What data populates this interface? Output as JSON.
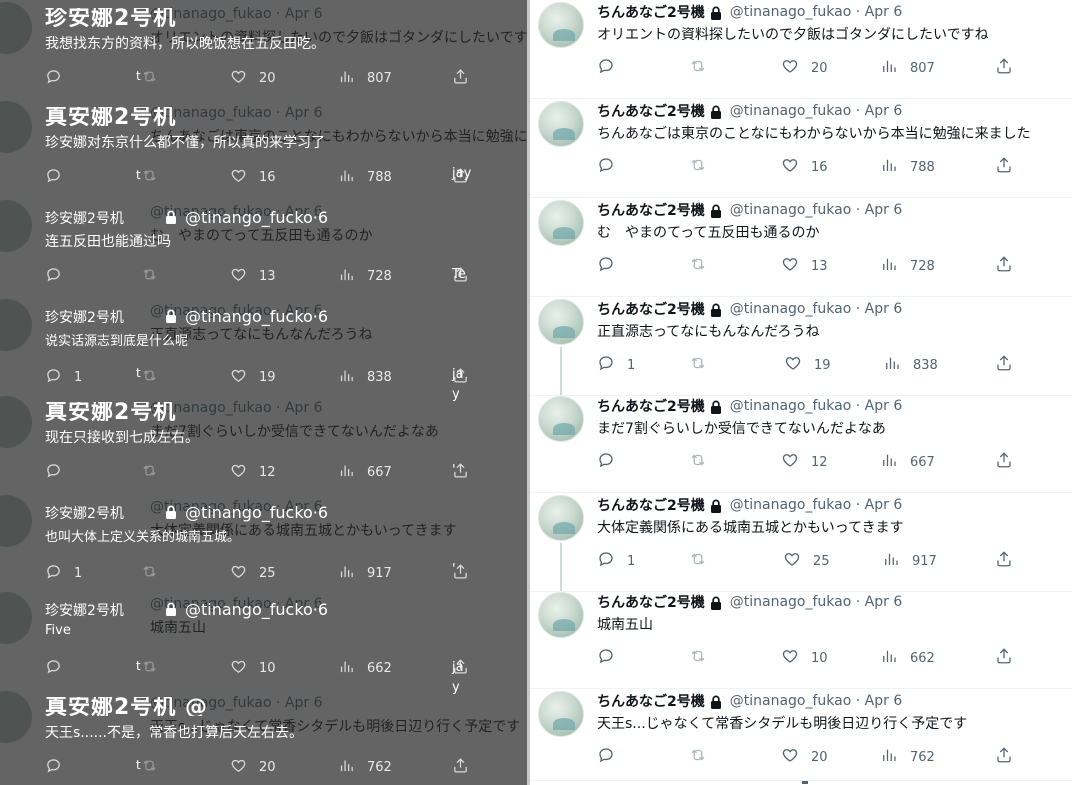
{
  "original_tweets": [
    {
      "name": "ちんあなご2号機",
      "handle": "@tinanago_fukao",
      "date": "Apr 6",
      "text": "オリエントの資料探したいので夕飯はゴタンダにしたいですね",
      "replies": "",
      "likes": "20",
      "views": "807"
    },
    {
      "name": "ちんあなご2号機",
      "handle": "@tinanago_fukao",
      "date": "Apr 6",
      "text": "ちんあなごは東京のことなにもわからないから本当に勉強に来ました",
      "replies": "",
      "likes": "16",
      "views": "788"
    },
    {
      "name": "ちんあなご2号機",
      "handle": "@tinanago_fukao",
      "date": "Apr 6",
      "text": "む　やまのてって五反田も通るのか",
      "replies": "",
      "likes": "13",
      "views": "728"
    },
    {
      "name": "ちんあなご2号機",
      "handle": "@tinanago_fukao",
      "date": "Apr 6",
      "text": "正直源志ってなにもんなんだろうね",
      "replies": "1",
      "likes": "19",
      "views": "838"
    },
    {
      "name": "ちんあなご2号機",
      "handle": "@tinanago_fukao",
      "date": "Apr 6",
      "text": "まだ7割ぐらいしか受信できてないんだよなあ",
      "replies": "",
      "likes": "12",
      "views": "667"
    },
    {
      "name": "ちんあなご2号機",
      "handle": "@tinanago_fukao",
      "date": "Apr 6",
      "text": "大体定義関係にある城南五城とかもいってきます",
      "replies": "1",
      "likes": "25",
      "views": "917"
    },
    {
      "name": "ちんあなご2号機",
      "handle": "@tinanago_fukao",
      "date": "Apr 6",
      "text": "城南五山",
      "replies": "",
      "likes": "10",
      "views": "662"
    },
    {
      "name": "ちんあなご2号機",
      "handle": "@tinanago_fukao",
      "date": "Apr 6",
      "text": "天王s...じゃなくて常香シタデルも明後日辺り行く予定です",
      "replies": "",
      "likes": "20",
      "views": "762"
    }
  ],
  "translated_tweets": [
    {
      "name": "珍安娜2号机",
      "handle_overlay": "",
      "text": "我想找东方的资料，所以晚饭想在五反田吃。",
      "replies": "",
      "retweet_mark": "t",
      "likes": "20",
      "views": "807",
      "side": ""
    },
    {
      "name": "真安娜2号机",
      "handle_overlay": "",
      "text": "珍安娜对东京什么都不懂，所以真的来学习了",
      "replies": "",
      "retweet_mark": "t",
      "likes": "16",
      "views": "788",
      "side": "jay"
    },
    {
      "name": "珍安娜2号机",
      "handle_overlay": "@tinango_fucko·6",
      "text": "连五反田也能通过吗",
      "replies": "",
      "retweet_mark": "",
      "likes": "13",
      "views": "728",
      "side": "Te"
    },
    {
      "name": "珍安娜2号机",
      "handle_overlay": "@tinango_fucko·6",
      "text": "说实话源志到底是什么呢",
      "replies": "1",
      "retweet_mark": "t",
      "likes": "19",
      "views": "838",
      "side": "ja\ny"
    },
    {
      "name": "真安娜2号机",
      "handle_overlay": "",
      "text": "现在只接收到七成左右。",
      "replies": "",
      "retweet_mark": "",
      "likes": "12",
      "views": "667",
      "side": "'"
    },
    {
      "name": "珍安娜2号机",
      "handle_overlay": "@tinango_fucko·6",
      "text": "也叫大体上定义关系的城南五城。",
      "replies": "1",
      "retweet_mark": "",
      "likes": "25",
      "views": "917",
      "side": "'"
    },
    {
      "name": "珍安娜2号机",
      "handle_overlay": "@tinango_fucko·6",
      "text": "Five",
      "replies": "",
      "retweet_mark": "t",
      "likes": "10",
      "views": "662",
      "side": "ja\ny"
    },
    {
      "name": "真安娜2号机 @",
      "handle_overlay": "",
      "text": "天王s......不是，常香也打算后天左右去。",
      "replies": "",
      "retweet_mark": "t",
      "likes": "20",
      "views": "762",
      "side": ""
    }
  ],
  "colors": {
    "text_primary": "#0f1419",
    "text_secondary": "#536471",
    "divider": "#eff3f4",
    "overlay_dim": "#282828"
  }
}
